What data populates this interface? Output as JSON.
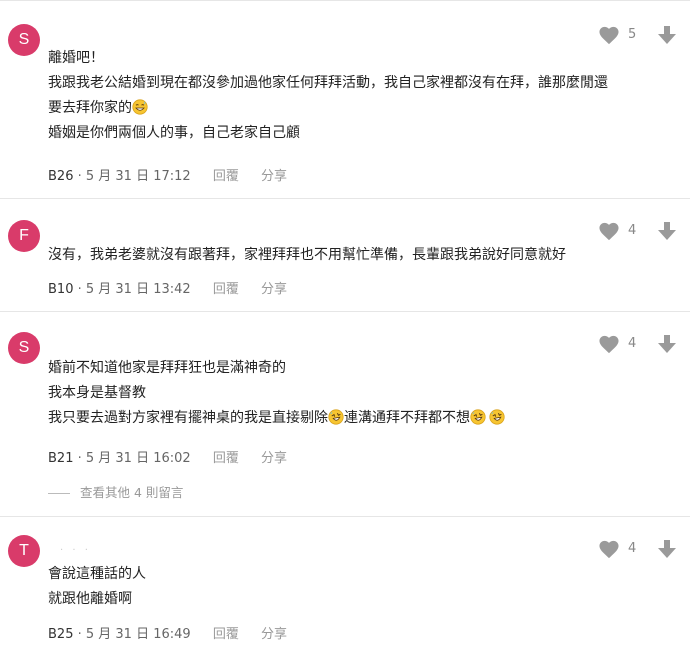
{
  "colors": {
    "avatar_s": "#d93b6a",
    "avatar_f": "#d93b6a",
    "avatar_t": "#d93b6a",
    "icon_gray": "#9a9a9a",
    "divider": "#e6e6e6"
  },
  "ui": {
    "reply_label": "回覆",
    "share_label": "分享"
  },
  "comments": [
    {
      "avatar_letter": "S",
      "likes": "5",
      "lines": [
        "離婚吧！",
        "我跟我老公結婚到現在都沒參加過他家任何拜拜活動，我自己家裡都沒有在拜，誰那麼閒還",
        "要去拜你家的",
        "婚姻是你們兩個人的事，自己老家自己顧"
      ],
      "floor": "B26",
      "date": "5 月 31 日 17:12",
      "emoji": [
        "smiling-sweat-emoji"
      ]
    },
    {
      "avatar_letter": "F",
      "likes": "4",
      "lines": [
        "沒有，我弟老婆就沒有跟著拜，家裡拜拜也不用幫忙準備，長輩跟我弟說好同意就好"
      ],
      "floor": "B10",
      "date": "5 月 31 日 13:42"
    },
    {
      "avatar_letter": "S",
      "likes": "4",
      "lines": [
        "婚前不知道他家是拜拜狂也是滿神奇的",
        "我本身是基督教",
        "我只要去過對方家裡有擺神桌的我是直接剔除",
        "連溝通拜不拜都不想"
      ],
      "floor": "B21",
      "date": "5 月 31 日 16:02",
      "more_replies": "查看其他 4 則留言",
      "emoji": [
        "rolling-laughing-emoji"
      ]
    },
    {
      "avatar_letter": "T",
      "likes": "4",
      "lines": [
        "會說這種話的人",
        "就跟他離婚啊"
      ],
      "floor": "B25",
      "date": "5 月 31 日 16:49"
    }
  ]
}
